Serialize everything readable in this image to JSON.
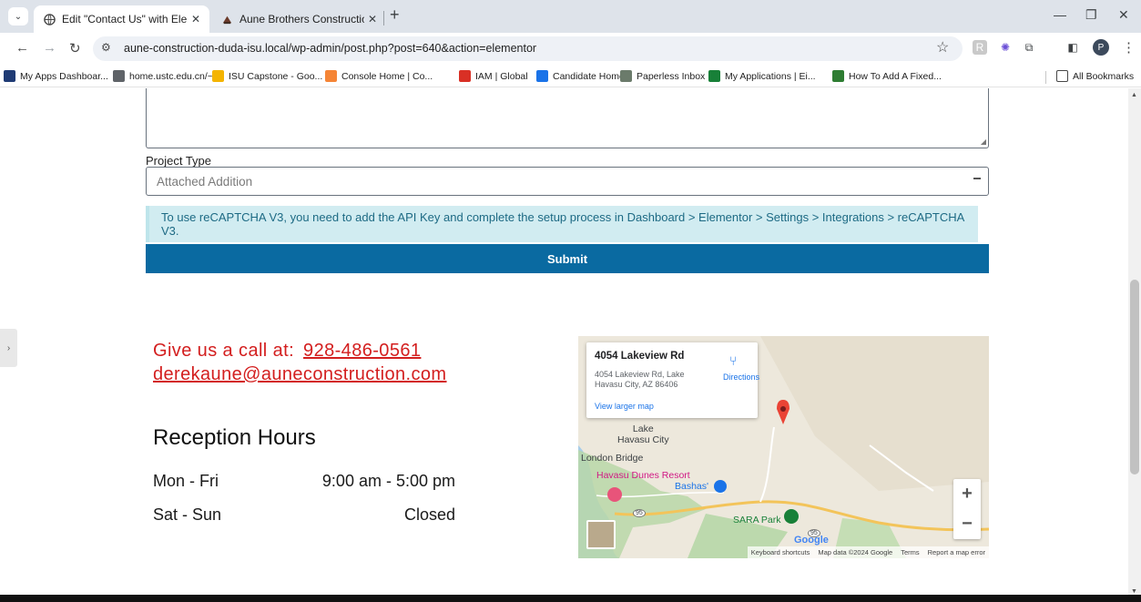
{
  "browser": {
    "tabs": [
      {
        "title": "Edit \"Contact Us\" with Elementor",
        "active": true
      },
      {
        "title": "Aune Brothers Construction",
        "active": false
      }
    ],
    "url": "aune-construction-duda-isu.local/wp-admin/post.php?post=640&action=elementor",
    "profile_initial": "P",
    "bookmarks": [
      {
        "label": "My Apps Dashboar...",
        "color": "#1f3b74"
      },
      {
        "label": "home.ustc.edu.cn/~...",
        "color": "#5f6368"
      },
      {
        "label": "ISU Capstone - Goo...",
        "color": "#f4b400"
      },
      {
        "label": "Console Home | Co...",
        "color": "#f58536"
      },
      {
        "label": "IAM | Global",
        "color": "#d93025"
      },
      {
        "label": "Candidate Home",
        "color": "#1a73e8"
      },
      {
        "label": "Paperless Inbox",
        "color": "#6b7b6b"
      },
      {
        "label": "My Applications | Ei...",
        "color": "#188038"
      },
      {
        "label": "How To Add A Fixed...",
        "color": "#2e7d32"
      }
    ],
    "all_bookmarks": "All Bookmarks"
  },
  "form": {
    "project_type_label": "Project Type",
    "project_type_value": "Attached Addition",
    "recaptcha_notice": "To use reCAPTCHA V3, you need to add the API Key and complete the setup process in Dashboard > Elementor > Settings > Integrations > reCAPTCHA V3.",
    "submit_label": "Submit"
  },
  "contact": {
    "call_prefix": "Give us a call at:",
    "phone": "928-486-0561",
    "email": "derekaune@auneconstruction.com"
  },
  "hours": {
    "title": "Reception Hours",
    "rows": [
      {
        "days": "Mon - Fri",
        "time": "9:00 am - 5:00 pm"
      },
      {
        "days": "Sat - Sun",
        "time": "Closed"
      }
    ]
  },
  "map": {
    "place_name": "4054 Lakeview Rd",
    "address": "4054 Lakeview Rd, Lake Havasu City, AZ 86406",
    "directions_label": "Directions",
    "larger_map_label": "View larger map",
    "labels": {
      "city": "Lake\nHavasu City",
      "london_bridge": "London Bridge",
      "resort": "Havasu Dunes Resort",
      "bashas": "Bashas'",
      "sara_park": "SARA Park",
      "route_95_a": "95",
      "route_95_b": "95"
    },
    "google": "Google",
    "footer": {
      "shortcuts": "Keyboard shortcuts",
      "data": "Map data ©2024 Google",
      "terms": "Terms",
      "report": "Report a map error"
    },
    "zoom_in": "+",
    "zoom_out": "−"
  }
}
